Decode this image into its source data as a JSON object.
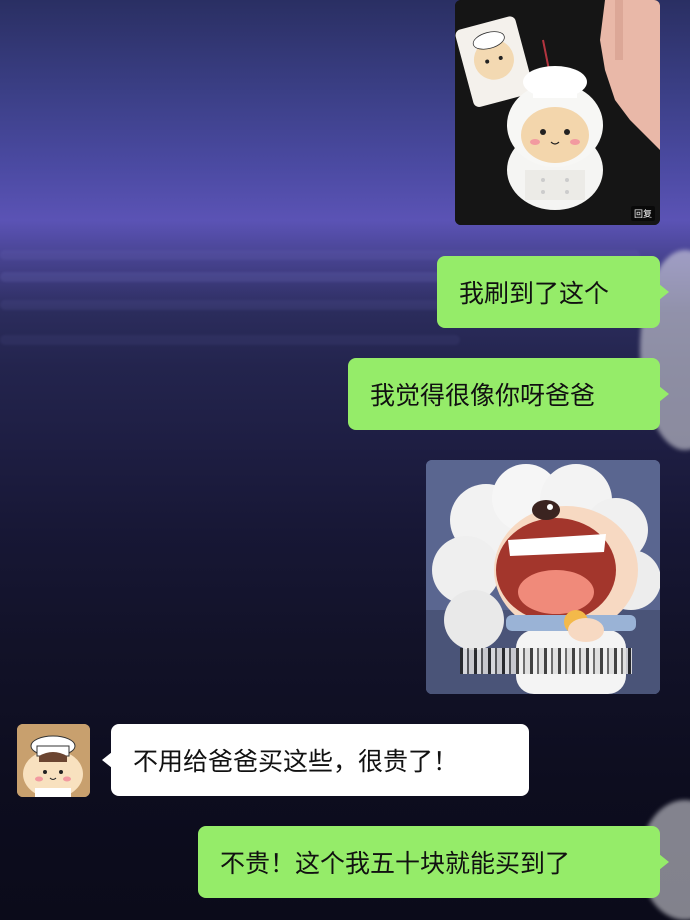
{
  "messages": [
    {
      "type": "image",
      "side": "right",
      "description_icon": "plush-toy-photo",
      "corner_tag": "回复"
    },
    {
      "type": "text",
      "side": "right",
      "text": "我刷到了这个"
    },
    {
      "type": "text",
      "side": "right",
      "text": "我觉得很像你呀爸爸"
    },
    {
      "type": "image",
      "side": "right",
      "description_icon": "laughing-sheep-sticker"
    },
    {
      "type": "text",
      "side": "left",
      "text": "不用给爸爸买这些，很贵了！"
    },
    {
      "type": "text",
      "side": "right",
      "text": "不贵！这个我五十块就能买到了"
    }
  ],
  "colors": {
    "outgoing_bubble": "#95ec69",
    "incoming_bubble": "#ffffff"
  }
}
